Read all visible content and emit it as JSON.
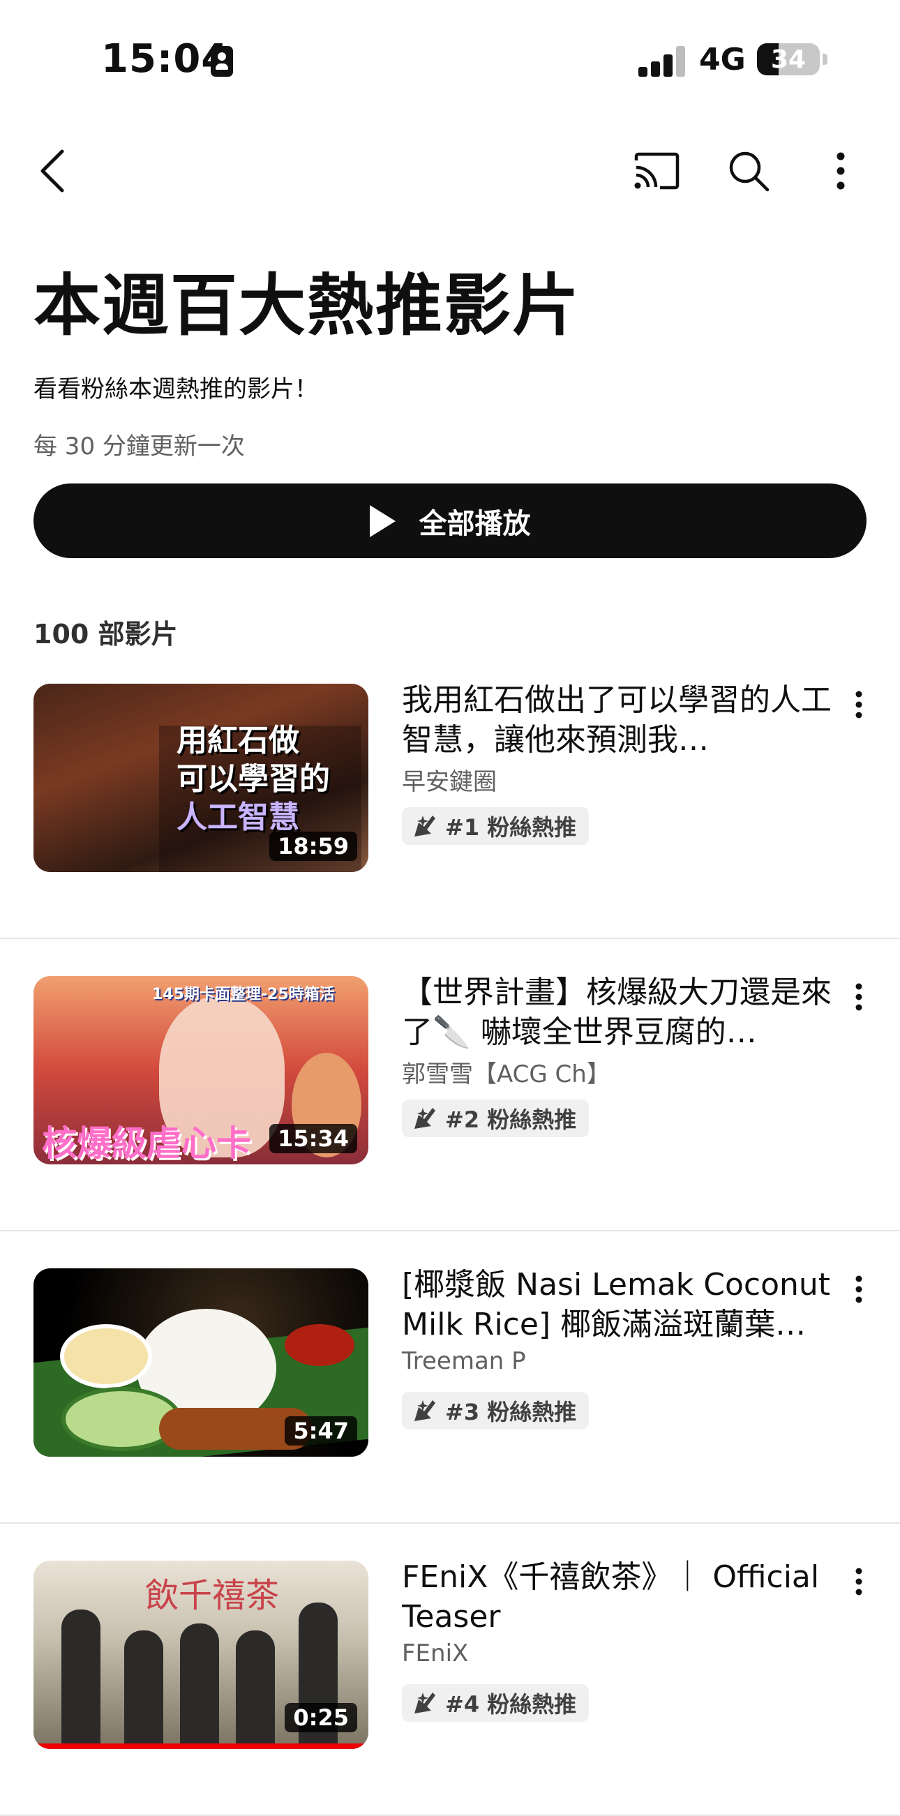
{
  "status_bar": {
    "time": "15:04",
    "network": "4G",
    "battery": "34",
    "battery_level": 0.34
  },
  "page": {
    "title": "本週百大熱推影片",
    "subtitle": "看看粉絲本週熱推的影片！",
    "update_note": "每 30 分鐘更新一次",
    "play_all_label": "全部播放",
    "video_count": "100 部影片"
  },
  "icons": {
    "back": "chevron-left-icon",
    "cast": "cast-icon",
    "search": "search-icon",
    "more": "more-vert-icon",
    "badge": "hype-icon"
  },
  "videos": [
    {
      "title": "我用紅石做出了可以學習的人工智慧，讓他來預測我…",
      "channel": "早安鍵圈",
      "duration": "18:59",
      "rank": "#1 粉絲熱推",
      "thumb_text": [
        "用紅石做",
        "可以學習的",
        "人工智慧"
      ]
    },
    {
      "title": "【世界計畫】核爆級大刀還是來了🔪 嚇壞全世界豆腐的…",
      "channel": "郭雪雪【ACG Ch】",
      "duration": "15:34",
      "rank": "#2 粉絲熱推",
      "thumb_text": [
        "145期卡面整理-25時箱活",
        "核爆級虐心卡"
      ]
    },
    {
      "title": "[椰漿飯 Nasi Lemak Coconut Milk Rice] 椰飯滿溢斑蘭葉…",
      "channel": "Treeman P",
      "duration": "5:47",
      "rank": "#3 粉絲熱推"
    },
    {
      "title": "FEniX《千禧飲茶》｜ Official Teaser",
      "channel": "FEniX",
      "duration": "0:25",
      "rank": "#4 粉絲熱推",
      "thumb_text": [
        "飲千禧茶"
      ]
    }
  ]
}
